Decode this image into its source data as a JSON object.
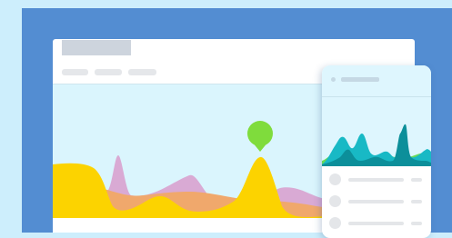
{
  "colors": {
    "page_background": "#cdeefc",
    "backdrop": "#538dd2",
    "hero_background": "#daf5fd",
    "wave_purple": "#d9aad4",
    "wave_orange": "#f0a86c",
    "wave_yellow": "#fcd300",
    "marker_green": "#7fdc3c",
    "mobile_teal": "#18b9c5",
    "mobile_dark_teal": "#0c8f9a",
    "mobile_green": "#68d957",
    "placeholder_gray": "#e4e6e9"
  },
  "browser": {
    "nav_placeholders": 3,
    "hero_chart": {
      "series": [
        "purple",
        "orange",
        "yellow"
      ],
      "marker": "green-map-pin-icon"
    }
  },
  "mobile": {
    "list_rows": 3
  }
}
